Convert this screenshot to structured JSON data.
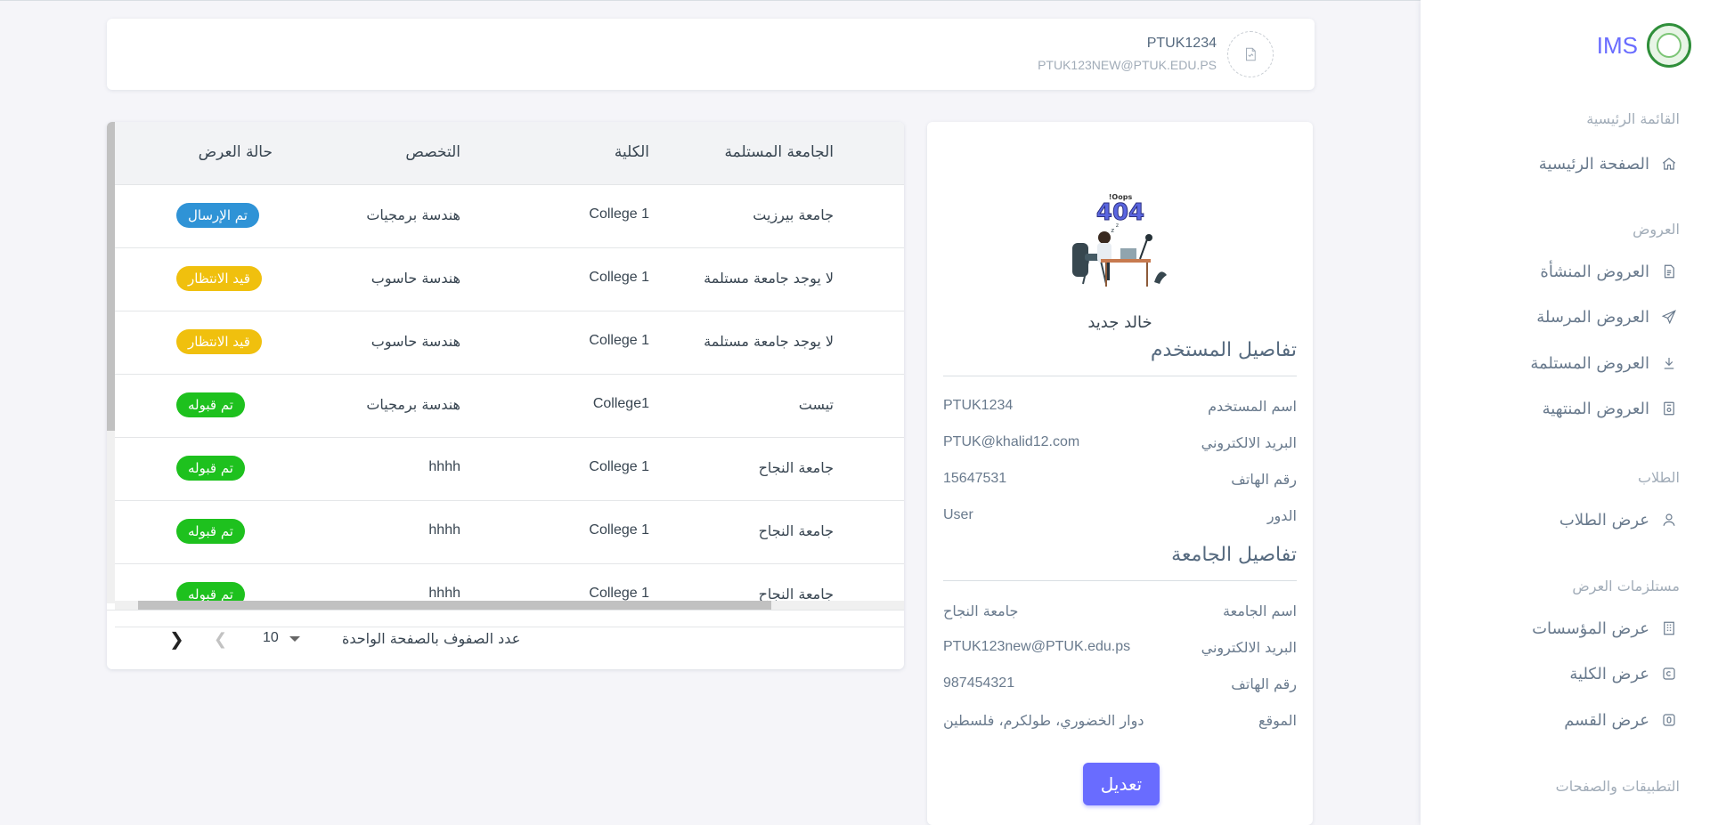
{
  "app": {
    "brand": "IMS"
  },
  "sidebar": {
    "sections": [
      {
        "header": "القائمة الرئيسية",
        "items": [
          {
            "label": "الصفحة الرئيسية",
            "icon": "home-icon"
          }
        ]
      },
      {
        "header": "العروض",
        "items": [
          {
            "label": "العروض المنشأة",
            "icon": "document-icon"
          },
          {
            "label": "العروض المرسلة",
            "icon": "send-icon"
          },
          {
            "label": "العروض المستلمة",
            "icon": "download-icon"
          },
          {
            "label": "العروض المنتهية",
            "icon": "certificate-icon"
          }
        ]
      },
      {
        "header": "الطلاب",
        "items": [
          {
            "label": "عرض الطلاب",
            "icon": "user-icon"
          }
        ]
      },
      {
        "header": "مستلزمات العرض",
        "items": [
          {
            "label": "عرض المؤسسات",
            "icon": "building-icon"
          },
          {
            "label": "عرض الكلية",
            "icon": "college-icon"
          },
          {
            "label": "عرض القسم",
            "icon": "department-icon"
          }
        ]
      },
      {
        "header": "التطبيقات والصفحات",
        "items": []
      }
    ]
  },
  "navbar": {
    "username": "PTUK1234",
    "email": "PTUK123NEW@PTUK.EDU.PS"
  },
  "profile": {
    "name": "خالد جديد",
    "user_section_title": "تفاصيل المستخدم",
    "user_rows": [
      {
        "label": "اسم المستخدم",
        "value": "PTUK1234"
      },
      {
        "label": "البريد الالكتروني",
        "value": "PTUK@khalid12.com"
      },
      {
        "label": "رقم الهاتف",
        "value": "15647531"
      },
      {
        "label": "الدور",
        "value": "User"
      }
    ],
    "university_section_title": "تفاصيل الجامعة",
    "university_rows": [
      {
        "label": "اسم الجامعة",
        "value": "جامعة النجاح"
      },
      {
        "label": "البريد الالكتروني",
        "value": "PTUK123new@PTUK.edu.ps"
      },
      {
        "label": "رقم الهاتف",
        "value": "987454321"
      },
      {
        "label": "الموقع",
        "value": "دوار الخضوري، طولكرم، فلسطين"
      }
    ],
    "edit_label": "تعديل",
    "illustration_text": "404",
    "illustration_caption": "Oops!"
  },
  "table": {
    "headers": [
      "الجامعة المستلمة",
      "الكلية",
      "التخصص",
      "حالة العرض"
    ],
    "rows": [
      {
        "university": "جامعة بيرزيت",
        "college": "College 1",
        "major": "هندسة برمجيات",
        "status": "تم الإرسال",
        "status_color": "#2f93d6"
      },
      {
        "university": "لا يوجد جامعة مستلمة",
        "college": "College 1",
        "major": "هندسة حاسوب",
        "status": "قيد الانتظار",
        "status_color": "#f0c00e"
      },
      {
        "university": "لا يوجد جامعة مستلمة",
        "college": "College 1",
        "major": "هندسة حاسوب",
        "status": "قيد الانتظار",
        "status_color": "#f0c00e"
      },
      {
        "university": "تيست",
        "college": "College1",
        "major": "هندسة برمجيات",
        "status": "تم قبوله",
        "status_color": "#1ec11e"
      },
      {
        "university": "جامعة النجاح",
        "college": "College 1",
        "major": "hhhh",
        "status": "تم قبوله",
        "status_color": "#1ec11e"
      },
      {
        "university": "جامعة النجاح",
        "college": "College 1",
        "major": "hhhh",
        "status": "تم قبوله",
        "status_color": "#1ec11e"
      },
      {
        "university": "جامعة النجاح",
        "college": "College 1",
        "major": "hhhh",
        "status": "تم قبوله",
        "status_color": "#1ec11e"
      }
    ],
    "pagination": {
      "rows_per_page_label": "عدد الصفوف بالصفحة الواحدة",
      "rows_per_page": "10",
      "prev_icon": "chevron-left-icon",
      "next_icon": "chevron-right-icon"
    }
  }
}
